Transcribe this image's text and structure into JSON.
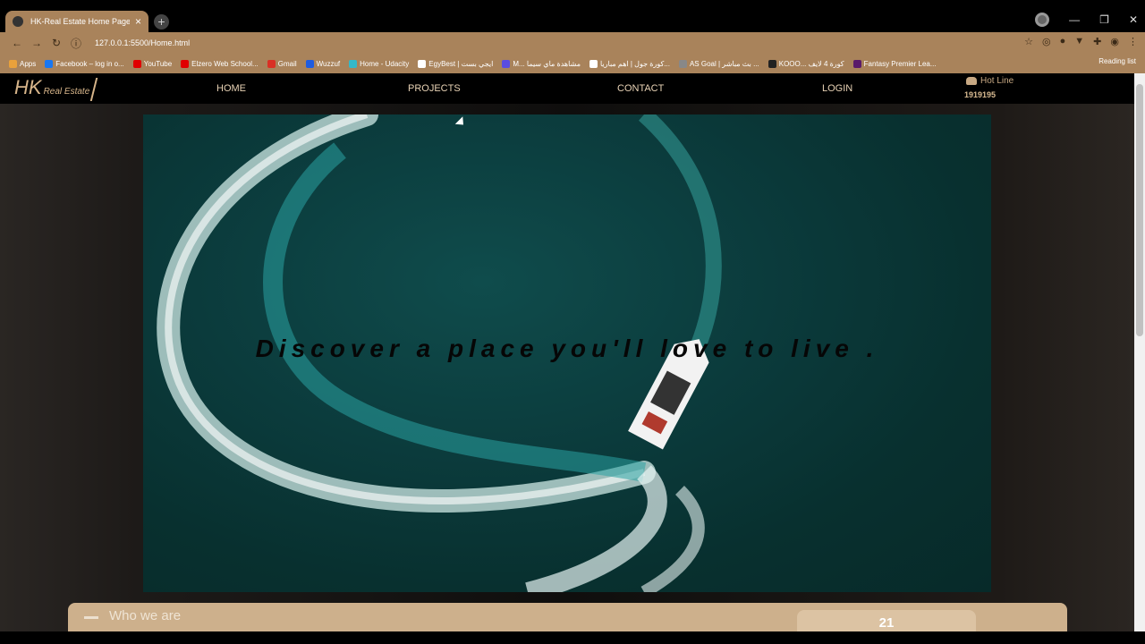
{
  "browser": {
    "tab_title": "HK-Real Estate Home Page",
    "tab_close": "×",
    "new_tab": "+",
    "url": "127.0.0.1:5500/Home.html",
    "bookmarks": [
      {
        "label": "Apps",
        "color": "#e9a13b"
      },
      {
        "label": "Facebook – log in o...",
        "color": "#1877f2"
      },
      {
        "label": "YouTube",
        "color": "#e00000"
      },
      {
        "label": "Elzero Web School...",
        "color": "#e00000"
      },
      {
        "label": "Gmail",
        "color": "#d93025"
      },
      {
        "label": "Wuzzuf",
        "color": "#1f5ce0"
      },
      {
        "label": "Home - Udacity",
        "color": "#34b8c9"
      },
      {
        "label": "EgyBest | ايجي بست",
        "color": "#ffffff"
      },
      {
        "label": "M... مشاهدة ماي سيما",
        "color": "#5a4de0"
      },
      {
        "label": "كورة جول | اهم مباريا...",
        "color": "#ffffff"
      },
      {
        "label": "AS Goal | بث مباشر ...",
        "color": "#888888"
      },
      {
        "label": "KOOO... كورة 4 لايف",
        "color": "#222222"
      },
      {
        "label": "Fantasy Premier Lea...",
        "color": "#5a1a6a"
      }
    ],
    "reading_list": "Reading list"
  },
  "site": {
    "logo_hk": "HK",
    "logo_sub": "Real Estate",
    "nav": {
      "home": "HOME",
      "projects": "PROJECTS",
      "contact": "CONTACT",
      "login": "LOGIN"
    },
    "hotline_label": "Hot Line",
    "hotline_number": "1919195",
    "hero_text": "Discover a place you'll love to live .",
    "who_label": "Who we are",
    "badge_number": "21"
  },
  "colors": {
    "accent": "#a9835b",
    "gold": "#cdb08c"
  }
}
